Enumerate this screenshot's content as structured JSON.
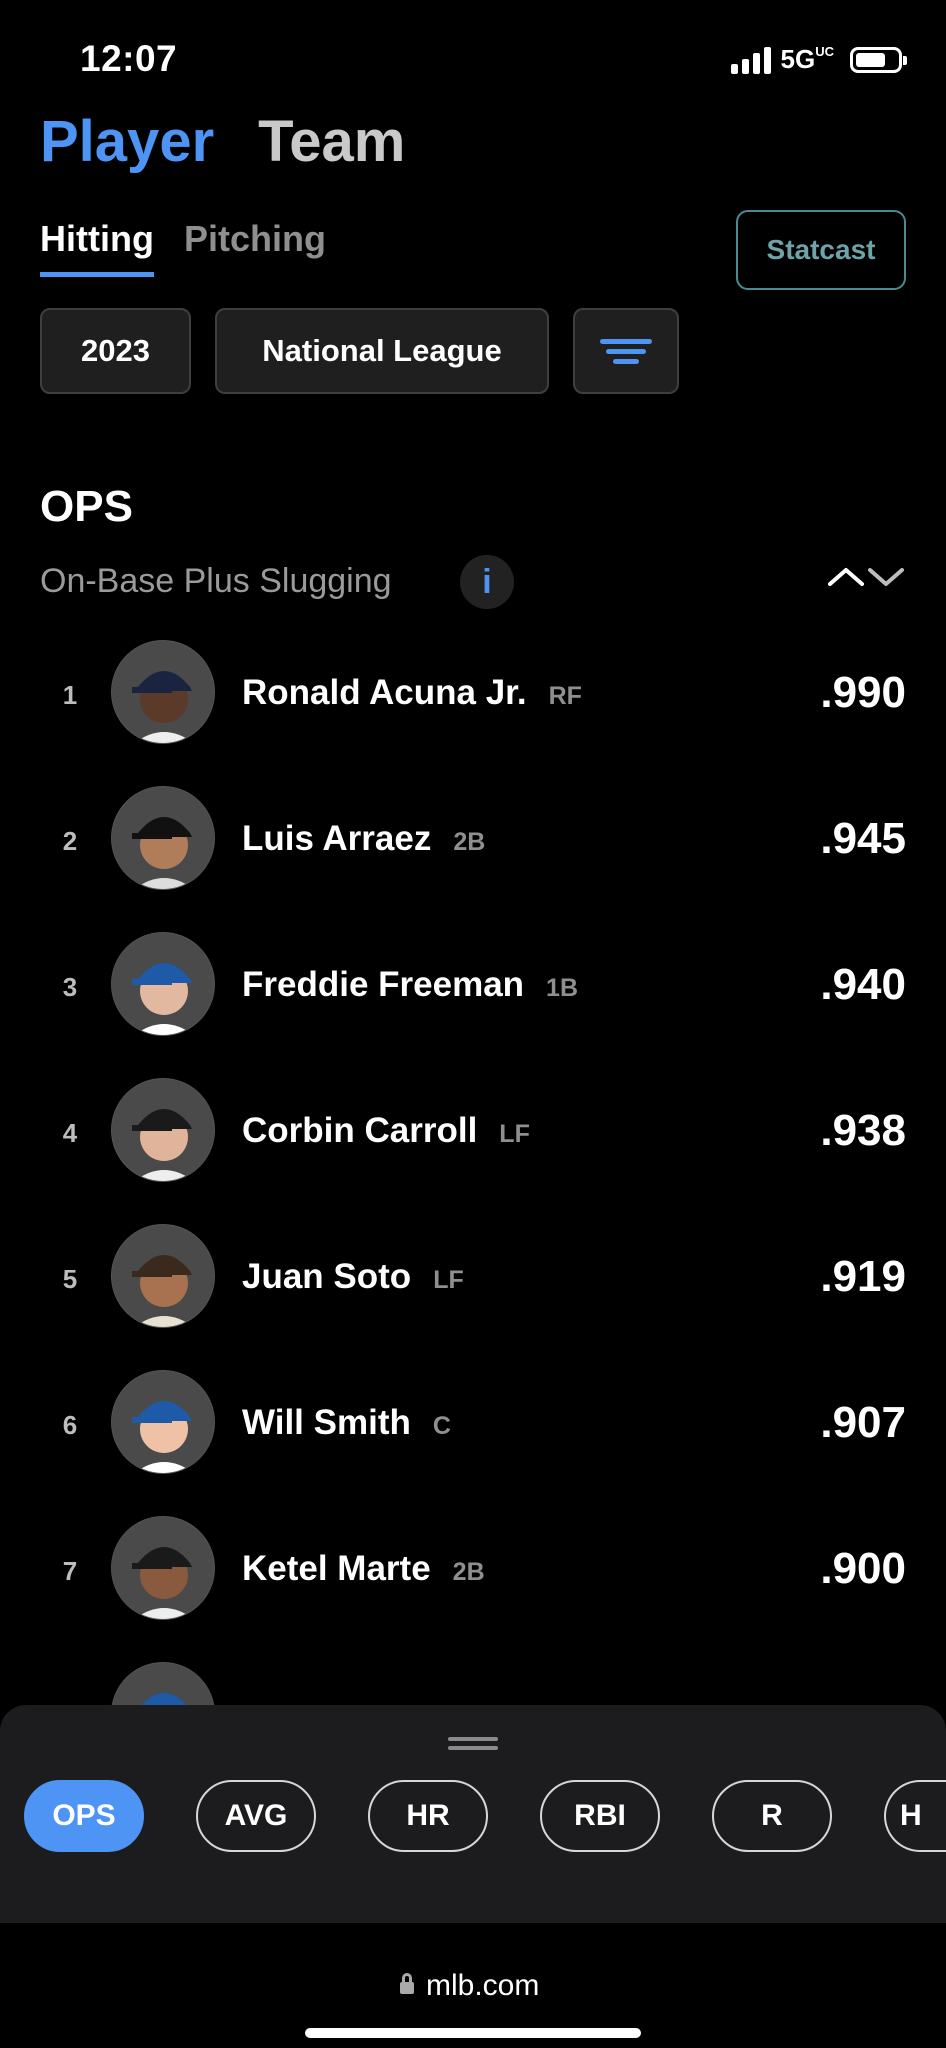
{
  "status_bar": {
    "time": "12:07",
    "network": "5G",
    "network_suffix": "UC"
  },
  "top_tabs": [
    {
      "label": "Player",
      "active": true
    },
    {
      "label": "Team",
      "active": false
    }
  ],
  "sub_tabs": [
    {
      "label": "Hitting",
      "active": true
    },
    {
      "label": "Pitching",
      "active": false
    }
  ],
  "statcast_label": "Statcast",
  "filters": {
    "year": "2023",
    "league": "National League",
    "filter_icon": "filter-icon"
  },
  "stat": {
    "title": "OPS",
    "description": "On-Base Plus Slugging",
    "info_icon": "info-icon",
    "info_glyph": "i"
  },
  "leaders": [
    {
      "rank": "1",
      "name": "Ronald Acuna Jr.",
      "position": "RF",
      "value": ".990"
    },
    {
      "rank": "2",
      "name": "Luis Arraez",
      "position": "2B",
      "value": ".945"
    },
    {
      "rank": "3",
      "name": "Freddie Freeman",
      "position": "1B",
      "value": ".940"
    },
    {
      "rank": "4",
      "name": "Corbin Carroll",
      "position": "LF",
      "value": ".938"
    },
    {
      "rank": "5",
      "name": "Juan Soto",
      "position": "LF",
      "value": ".919"
    },
    {
      "rank": "6",
      "name": "Will Smith",
      "position": "C",
      "value": ".907"
    },
    {
      "rank": "7",
      "name": "Ketel Marte",
      "position": "2B",
      "value": ".900"
    }
  ],
  "stat_chips": [
    {
      "label": "OPS",
      "active": true
    },
    {
      "label": "AVG",
      "active": false
    },
    {
      "label": "HR",
      "active": false
    },
    {
      "label": "RBI",
      "active": false
    },
    {
      "label": "R",
      "active": false
    },
    {
      "label": "H",
      "active": false
    }
  ],
  "browser": {
    "url": "mlb.com"
  },
  "colors": {
    "accent": "#4d94f5",
    "statcast_border": "#4b8a92",
    "sheet": "#1c1c1e"
  }
}
